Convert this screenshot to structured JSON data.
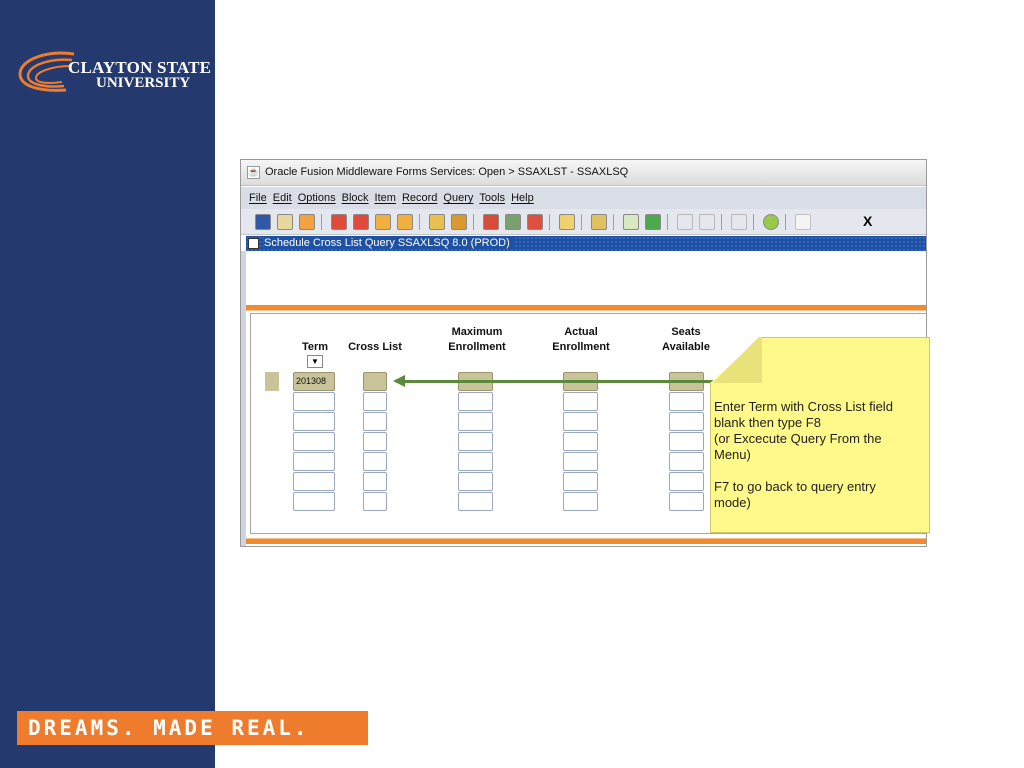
{
  "slide": {
    "logo_line1": "CLAYTON STATE",
    "logo_line2": "UNIVERSITY",
    "tagline": "DREAMS. MADE REAL.",
    "colors": {
      "sidebar": "#243a6e",
      "accent": "#ef7b2d"
    }
  },
  "window": {
    "title": "Oracle Fusion Middleware Forms Services:  Open > SSAXLST - SSAXLSQ",
    "menu": [
      "File",
      "Edit",
      "Options",
      "Block",
      "Item",
      "Record",
      "Query",
      "Tools",
      "Help"
    ],
    "toolbar_close": "X",
    "toolbar_icons": [
      "save-icon",
      "rollback-icon",
      "print-icon",
      "previous-block-icon",
      "next-block-icon",
      "previous-record-icon",
      "next-record-icon",
      "enter-query-icon",
      "execute-query-icon",
      "cancel-query-icon",
      "insert-record-icon",
      "delete-record-icon",
      "clear-record-icon",
      "lov-icon",
      "export-icon",
      "search-icon",
      "add-icon",
      "navigate-icon",
      "crosshair-icon",
      "options-icon",
      "help-icon",
      "blank-icon"
    ],
    "form_title": "Schedule Cross List Query  SSAXLSQ  8.0  (PROD)"
  },
  "form": {
    "columns": {
      "term": "Term",
      "cross_list": "Cross List",
      "max_enrollment_1": "Maximum",
      "max_enrollment_2": "Enrollment",
      "actual_enrollment_1": "Actual",
      "actual_enrollment_2": "Enrollment",
      "seats_1": "Seats",
      "seats_2": "Available"
    },
    "term_value": "201308",
    "lov_icon": "chevron-down-icon",
    "row_count": 7
  },
  "callout": {
    "lines": [
      "Enter Term with Cross List field",
      "blank then type F8",
      "(or Excecute Query From the",
      "Menu)",
      "",
      "F7 to go back to query entry",
      "mode)"
    ]
  }
}
